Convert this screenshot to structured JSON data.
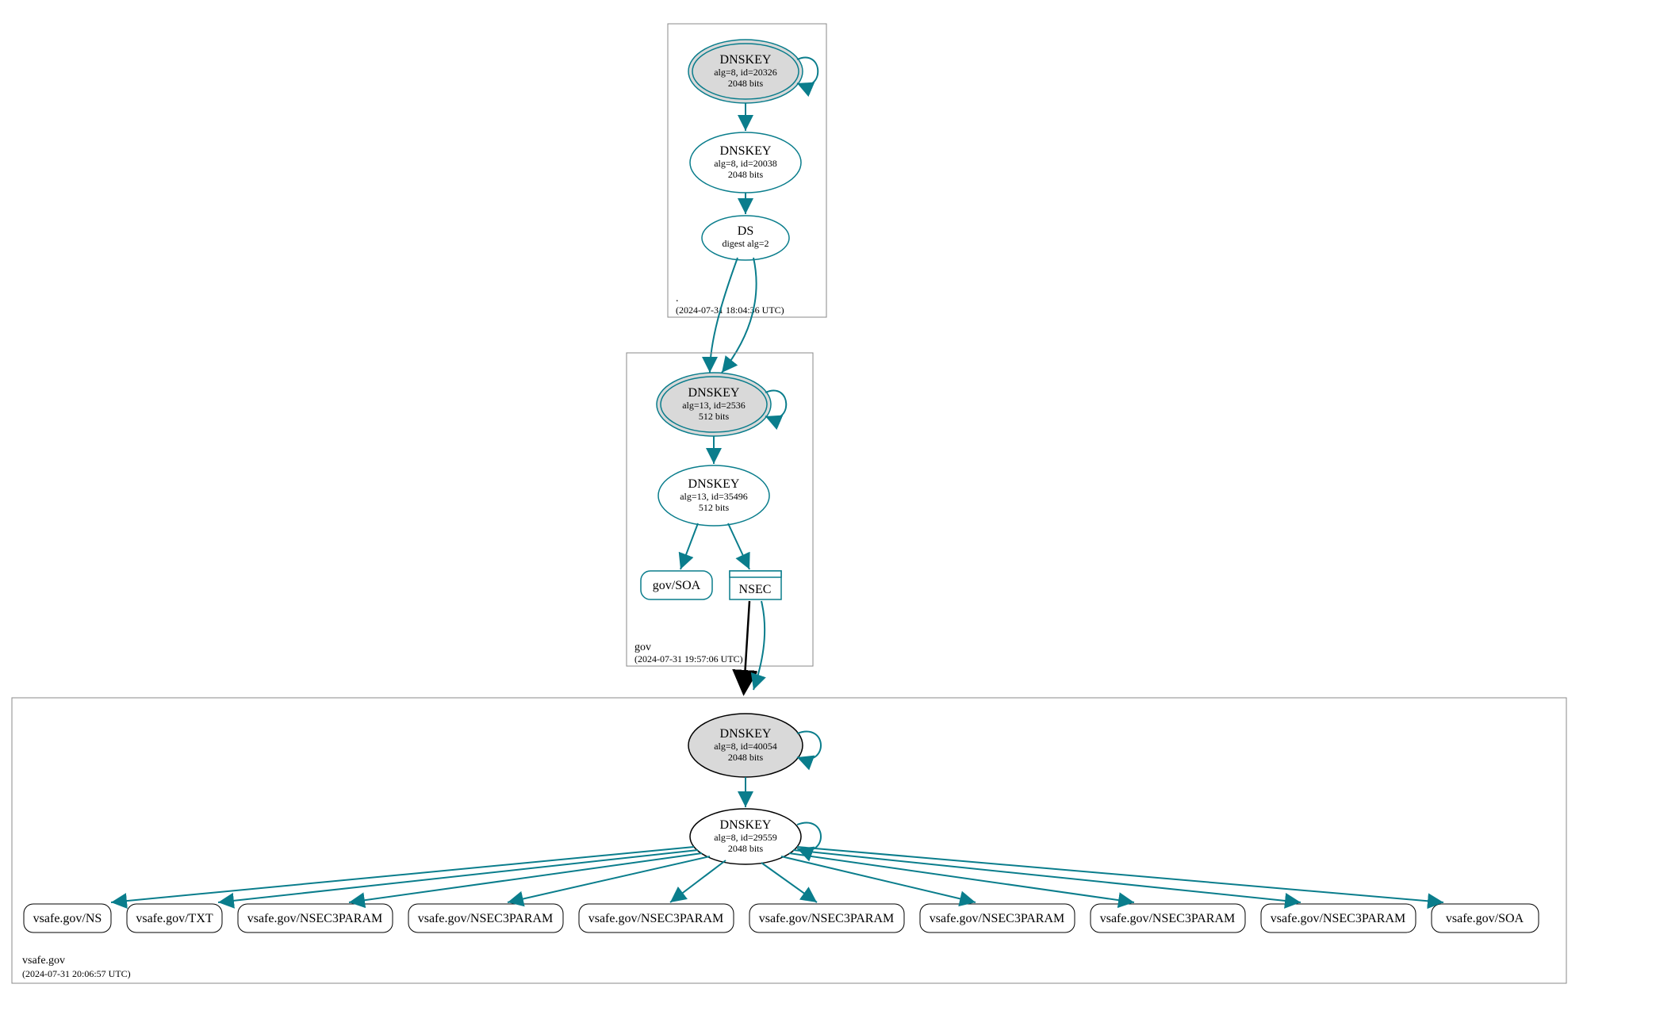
{
  "zones": {
    "root": {
      "name": ".",
      "timestamp": "(2024-07-31 18:04:36 UTC)",
      "ksk": {
        "title": "DNSKEY",
        "sub1": "alg=8, id=20326",
        "sub2": "2048 bits"
      },
      "zsk": {
        "title": "DNSKEY",
        "sub1": "alg=8, id=20038",
        "sub2": "2048 bits"
      },
      "ds": {
        "title": "DS",
        "sub1": "digest alg=2"
      }
    },
    "gov": {
      "name": "gov",
      "timestamp": "(2024-07-31 19:57:06 UTC)",
      "ksk": {
        "title": "DNSKEY",
        "sub1": "alg=13, id=2536",
        "sub2": "512 bits"
      },
      "zsk": {
        "title": "DNSKEY",
        "sub1": "alg=13, id=35496",
        "sub2": "512 bits"
      },
      "soa": "gov/SOA",
      "nsec": "NSEC"
    },
    "vsafe": {
      "name": "vsafe.gov",
      "timestamp": "(2024-07-31 20:06:57 UTC)",
      "ksk": {
        "title": "DNSKEY",
        "sub1": "alg=8, id=40054",
        "sub2": "2048 bits"
      },
      "zsk": {
        "title": "DNSKEY",
        "sub1": "alg=8, id=29559",
        "sub2": "2048 bits"
      },
      "records": [
        "vsafe.gov/NS",
        "vsafe.gov/TXT",
        "vsafe.gov/NSEC3PARAM",
        "vsafe.gov/NSEC3PARAM",
        "vsafe.gov/NSEC3PARAM",
        "vsafe.gov/NSEC3PARAM",
        "vsafe.gov/NSEC3PARAM",
        "vsafe.gov/NSEC3PARAM",
        "vsafe.gov/NSEC3PARAM",
        "vsafe.gov/SOA"
      ]
    }
  }
}
